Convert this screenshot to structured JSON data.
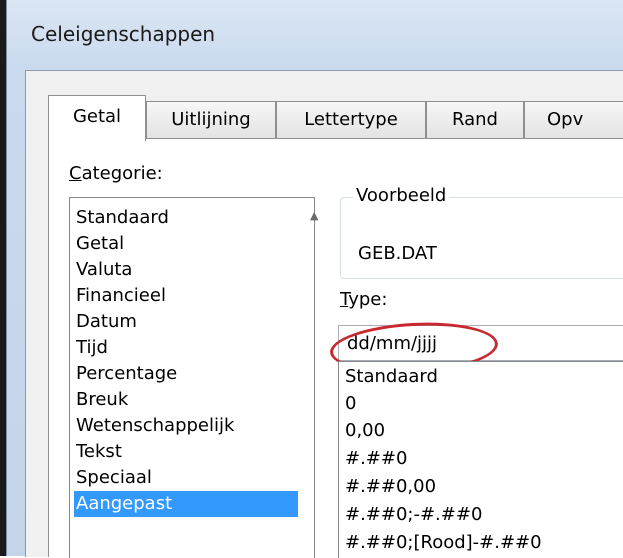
{
  "window": {
    "title": "Celeigenschappen"
  },
  "tabs": [
    {
      "label": "Getal",
      "active": true
    },
    {
      "label": "Uitlijning",
      "active": false
    },
    {
      "label": "Lettertype",
      "active": false
    },
    {
      "label": "Rand",
      "active": false
    },
    {
      "label": "Opv",
      "active": false
    }
  ],
  "category": {
    "label_underlined": "C",
    "label_rest": "ategorie:",
    "items": [
      "Standaard",
      "Getal",
      "Valuta",
      "Financieel",
      "Datum",
      "Tijd",
      "Percentage",
      "Breuk",
      "Wetenschappelijk",
      "Tekst",
      "Speciaal",
      "Aangepast"
    ],
    "selected": "Aangepast"
  },
  "preview": {
    "title": "Voorbeeld",
    "value": "GEB.DAT"
  },
  "type": {
    "label_underlined": "T",
    "label_rest": "ype:",
    "value": "dd/mm/jjjj",
    "items": [
      "Standaard",
      "0",
      "0,00",
      "#.##0",
      "#.##0,00",
      "#.##0;-#.##0",
      "#.##0;[Rood]-#.##0"
    ]
  },
  "colors": {
    "selection": "#3399ff",
    "annotation_ring": "#c8282f"
  }
}
